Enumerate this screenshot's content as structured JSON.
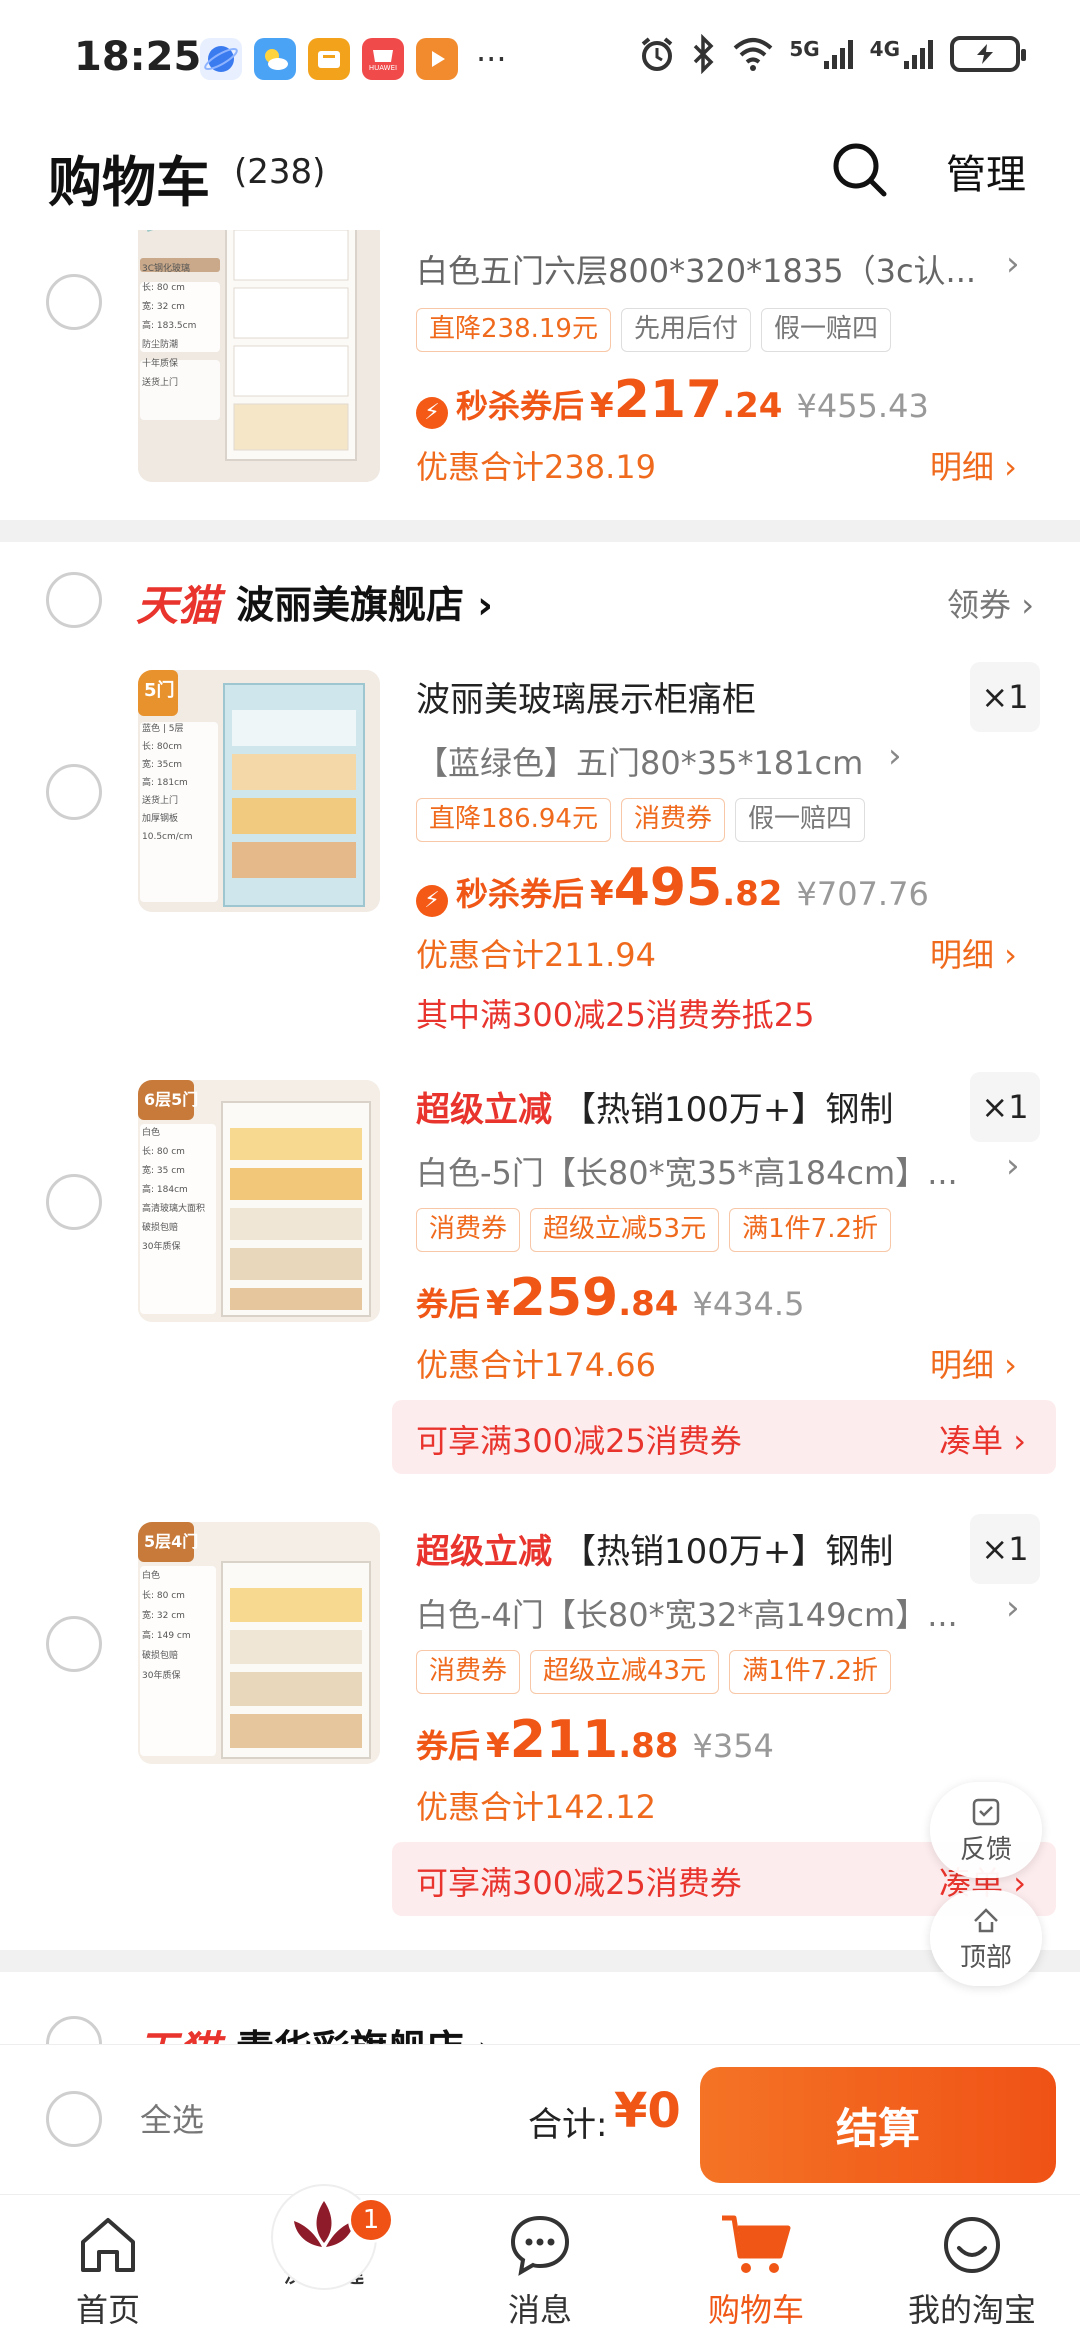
{
  "status_bar": {
    "time": "18:25",
    "icons": [
      "browser-icon",
      "weather-icon",
      "wallet-icon",
      "huawei-icon",
      "video-icon"
    ],
    "huawei_label": "HUAWEI",
    "more": "···",
    "right_icons": [
      "alarm-icon",
      "bluetooth-icon",
      "wifi-icon",
      "signal-5g-icon",
      "signal-4g-icon",
      "battery-icon"
    ],
    "net1": "5G",
    "net2": "4G"
  },
  "header": {
    "title": "购物车",
    "count": "(238)",
    "manage": "管理"
  },
  "items": [
    {
      "title": "白色五门六层800*320*1835（3c认...",
      "tags": [
        {
          "text": "直降238.19元",
          "style": "orange"
        },
        {
          "text": "先用后付",
          "style": "gray"
        },
        {
          "text": "假一赔四",
          "style": "gray"
        }
      ],
      "price_label": "秒杀券后",
      "price_yen": "¥",
      "price_int": "217",
      "price_dec": ".24",
      "orig_price": "¥455.43",
      "discount": "优惠合计238.19",
      "detail": "明细 ›"
    },
    {
      "title": "波丽美玻璃展示柜痛柜",
      "sku": "【蓝绿色】五门80*35*181cm",
      "qty": "×1",
      "tags": [
        {
          "text": "直降186.94元",
          "style": "orange"
        },
        {
          "text": "消费券",
          "style": "orange"
        },
        {
          "text": "假一赔四",
          "style": "gray"
        }
      ],
      "price_label": "秒杀券后",
      "price_yen": "¥",
      "price_int": "495",
      "price_dec": ".82",
      "orig_price": "¥707.76",
      "discount": "优惠合计211.94",
      "detail": "明细 ›",
      "note": "其中满300减25消费券抵25"
    },
    {
      "super_label": "超级立减",
      "title": "【热销100万+】钢制",
      "sku": "白色-5门【长80*宽35*高184cm】...",
      "qty": "×1",
      "tags": [
        {
          "text": "消费券",
          "style": "orange"
        },
        {
          "text": "超级立减53元",
          "style": "orange"
        },
        {
          "text": "满1件7.2折",
          "style": "orange"
        }
      ],
      "price_label": "券后",
      "price_yen": "¥",
      "price_int": "259",
      "price_dec": ".84",
      "orig_price": "¥434.5",
      "discount": "优惠合计174.66",
      "detail": "明细 ›",
      "promo": "可享满300减25消费券",
      "promo_link": "凑单 ›"
    },
    {
      "super_label": "超级立减",
      "title": "【热销100万+】钢制",
      "sku": "白色-4门【长80*宽32*高149cm】...",
      "qty": "×1",
      "tags": [
        {
          "text": "消费券",
          "style": "orange"
        },
        {
          "text": "超级立减43元",
          "style": "orange"
        },
        {
          "text": "满1件7.2折",
          "style": "orange"
        }
      ],
      "price_label": "券后",
      "price_yen": "¥",
      "price_int": "211",
      "price_dec": ".88",
      "orig_price": "¥354",
      "discount": "优惠合计142.12",
      "promo": "可享满300减25消费券",
      "promo_link": "凑单 ›"
    }
  ],
  "thumbs": {
    "t1": [
      "3C钢化玻璃",
      "长: 80 cm",
      "宽: 32 cm",
      "高: 183.5cm",
      "防尘防潮",
      "十年质保",
      "送货上门"
    ],
    "t2": [
      "5门",
      "蓝色 | 5层",
      "长: 80cm",
      "宽: 35cm",
      "高: 181cm",
      "送货上门",
      "加厚钢板",
      "10.5cm/cm"
    ],
    "t3": [
      "6层5门",
      "白色",
      "长: 80 cm",
      "宽: 35 cm",
      "高: 184cm",
      "高清玻璃大面积",
      "破损包赔",
      "30年质保"
    ],
    "t4": [
      "5层4门",
      "白色",
      "长: 80 cm",
      "宽: 32 cm",
      "高: 149 cm",
      "破损包赔",
      "30年质保"
    ]
  },
  "store": {
    "platform": "天猫",
    "name": "波丽美旗舰店",
    "coupon": "领券 ›"
  },
  "next_store": {
    "platform": "天猫",
    "name": "青华彩旗舰店 ›"
  },
  "fabs": {
    "feedback": "反馈",
    "top": "顶部"
  },
  "checkout": {
    "select_all": "全选",
    "total_label": "合计:",
    "total_value": "¥0",
    "pay": "结算"
  },
  "tabs": [
    {
      "label": "首页",
      "icon": "home-icon"
    },
    {
      "label": "汉尚华莲",
      "icon": "brand-logo-icon",
      "badge": "1"
    },
    {
      "label": "消息",
      "icon": "message-icon"
    },
    {
      "label": "购物车",
      "icon": "cart-icon",
      "active": true
    },
    {
      "label": "我的淘宝",
      "icon": "profile-icon"
    }
  ],
  "colors": {
    "accent": "#f05716",
    "red": "#e8342c",
    "promo_bg": "#fdecee"
  }
}
